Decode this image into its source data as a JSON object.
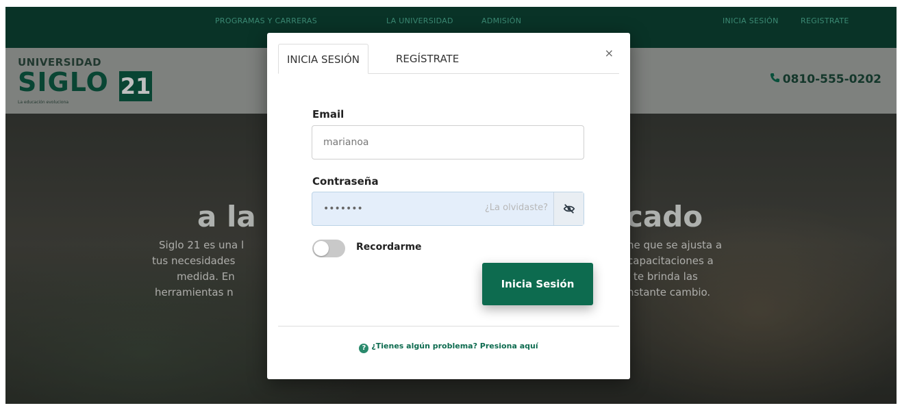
{
  "nav": {
    "programs": "PROGRAMAS Y CARRERAS",
    "university": "LA UNIVERSIDAD",
    "admission": "ADMISIÓN",
    "login": "INICIA SESIÓN",
    "register": "REGISTRATE"
  },
  "header": {
    "logo_top": "UNIVERSIDAD",
    "logo_main": "SIGLO",
    "logo_number": "21",
    "logo_tagline": "La educación evoluciona",
    "phone": "0810-555-0202"
  },
  "hero": {
    "title_left": "a la",
    "title_right": "cado",
    "text_left": [
      "Siglo 21 es una l",
      "tus necesidades",
      "medida. En",
      "herramientas n"
    ],
    "text_right": [
      "ne que se ajusta a",
      "capacitaciones a",
      "l te brinda las",
      "nstante cambio."
    ]
  },
  "modal": {
    "tab_login": "INICIA SESIÓN",
    "tab_register": "REGÍSTRATE",
    "close": "×",
    "email_label": "Email",
    "email_value": "marianoa",
    "password_label": "Contraseña",
    "password_value": "•••••••",
    "forgot": "¿La olvidaste?",
    "remember": "Recordarme",
    "submit": "Inicia Sesión",
    "help": "¿Tienes algún problema? Presiona aquí"
  },
  "icons": {
    "phone": "phone-icon",
    "eye": "eye-slash-icon",
    "help": "question-circle-icon"
  },
  "colors": {
    "brand_green": "#0d6b4f",
    "nav_bg": "#0d4535"
  }
}
